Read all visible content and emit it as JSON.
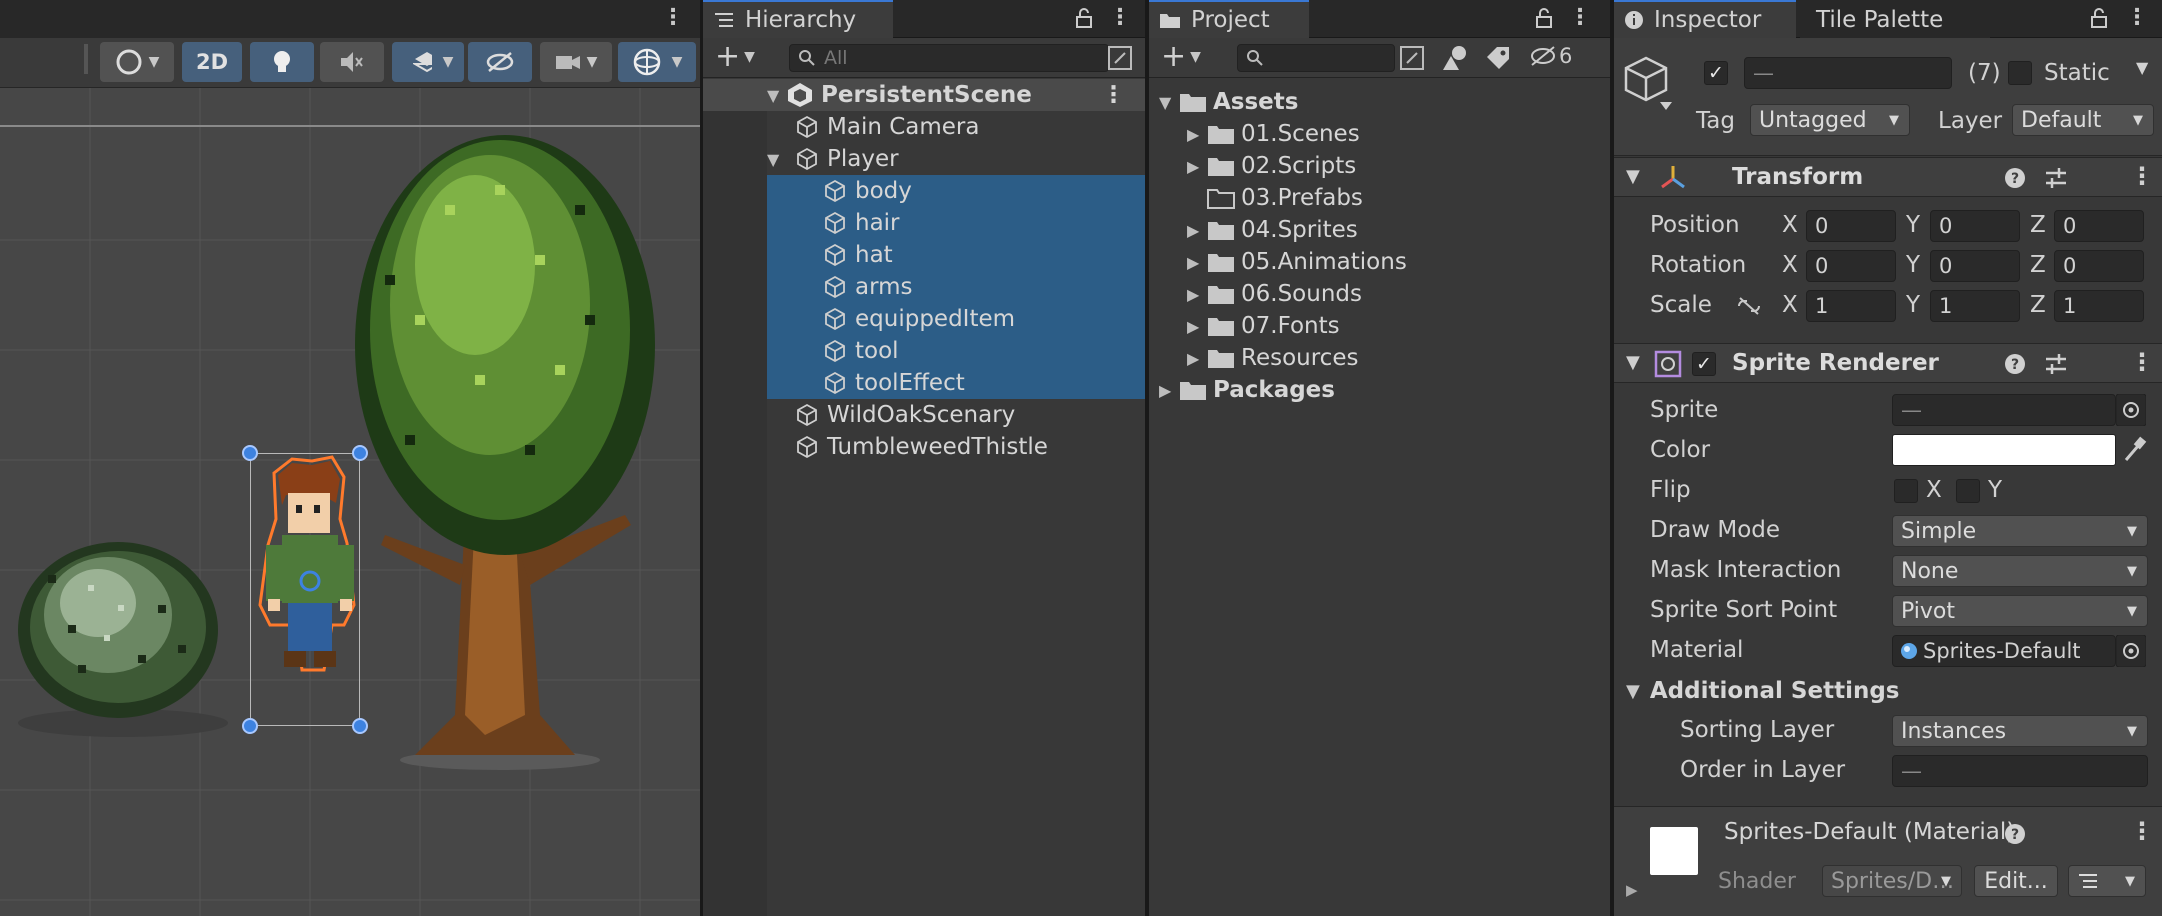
{
  "scene": {
    "toolbar": {
      "mode_2d": "2D"
    }
  },
  "hierarchy": {
    "tab_label": "Hierarchy",
    "search_placeholder": "All",
    "scene_name": "PersistentScene",
    "items": [
      {
        "label": "Main Camera",
        "indent": 1,
        "selected": false
      },
      {
        "label": "Player",
        "indent": 1,
        "expanded": true,
        "selected": false
      },
      {
        "label": "body",
        "indent": 2,
        "selected": true
      },
      {
        "label": "hair",
        "indent": 2,
        "selected": true
      },
      {
        "label": "hat",
        "indent": 2,
        "selected": true
      },
      {
        "label": "arms",
        "indent": 2,
        "selected": true
      },
      {
        "label": "equippedItem",
        "indent": 2,
        "selected": true
      },
      {
        "label": "tool",
        "indent": 2,
        "selected": true
      },
      {
        "label": "toolEffect",
        "indent": 2,
        "selected": true
      },
      {
        "label": "WildOakScenary",
        "indent": 1,
        "selected": false
      },
      {
        "label": "TumbleweedThistle",
        "indent": 1,
        "selected": false
      }
    ]
  },
  "project": {
    "tab_label": "Project",
    "hidden_count": "6",
    "root": "Assets",
    "folders": [
      {
        "label": "01.Scenes",
        "expandable": true
      },
      {
        "label": "02.Scripts",
        "expandable": true
      },
      {
        "label": "03.Prefabs",
        "expandable": false
      },
      {
        "label": "04.Sprites",
        "expandable": true
      },
      {
        "label": "05.Animations",
        "expandable": true
      },
      {
        "label": "06.Sounds",
        "expandable": true
      },
      {
        "label": "07.Fonts",
        "expandable": true
      },
      {
        "label": "Resources",
        "expandable": true
      }
    ],
    "packages": "Packages"
  },
  "inspector": {
    "tab_label": "Inspector",
    "tab2_label": "Tile Palette",
    "object_name": "—",
    "object_count": "(7)",
    "static_label": "Static",
    "tag_label": "Tag",
    "tag_value": "Untagged",
    "layer_label": "Layer",
    "layer_value": "Default",
    "transform": {
      "title": "Transform",
      "position_label": "Position",
      "rotation_label": "Rotation",
      "scale_label": "Scale",
      "axis_x": "X",
      "axis_y": "Y",
      "axis_z": "Z",
      "position": [
        "0",
        "0",
        "0"
      ],
      "rotation": [
        "0",
        "0",
        "0"
      ],
      "scale": [
        "1",
        "1",
        "1"
      ]
    },
    "sprite_renderer": {
      "title": "Sprite Renderer",
      "sprite_label": "Sprite",
      "sprite_value": "—",
      "color_label": "Color",
      "color_value": "#ffffff",
      "flip_label": "Flip",
      "flip_x": "X",
      "flip_y": "Y",
      "draw_mode_label": "Draw Mode",
      "draw_mode_value": "Simple",
      "mask_label": "Mask Interaction",
      "mask_value": "None",
      "sort_point_label": "Sprite Sort Point",
      "sort_point_value": "Pivot",
      "material_label": "Material",
      "material_value": "Sprites-Default",
      "additional_title": "Additional Settings",
      "sorting_layer_label": "Sorting Layer",
      "sorting_layer_value": "Instances",
      "order_label": "Order in Layer",
      "order_value": "—"
    },
    "material": {
      "title": "Sprites-Default (Material)",
      "shader_label": "Shader",
      "shader_value": "Sprites/D…",
      "edit_label": "Edit..."
    }
  },
  "colors": {
    "selection": "#2c5d87",
    "accent": "#3a78d4",
    "panel_bg": "#383838"
  }
}
